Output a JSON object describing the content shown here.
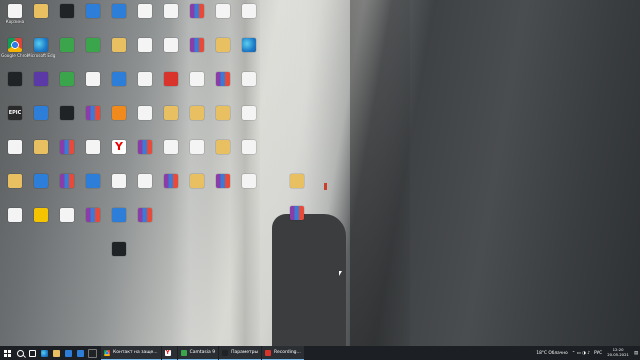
{
  "desktop": {
    "colors": {
      "taskbar_bg": "#1c1f23",
      "active_underline": "#76b9ed"
    },
    "icons": [
      {
        "label": "Корзина",
        "glyph": "recycle-bin"
      },
      {
        "label": "",
        "glyph": "folder"
      },
      {
        "label": "",
        "glyph": "app-dark"
      },
      {
        "label": "",
        "glyph": "app-blue"
      },
      {
        "label": "steam-icon",
        "glyph": "steam"
      },
      {
        "label": "",
        "glyph": "document"
      },
      {
        "label": "",
        "glyph": "document"
      },
      {
        "label": "",
        "glyph": "winrar-archive"
      },
      {
        "label": "",
        "glyph": "document"
      },
      {
        "label": "",
        "glyph": "document"
      },
      {
        "label": "Google Chrome",
        "glyph": "chrome"
      },
      {
        "label": "Microsoft Edge",
        "glyph": "edge"
      },
      {
        "label": "",
        "glyph": "app-green"
      },
      {
        "label": "",
        "glyph": "app-green"
      },
      {
        "label": "",
        "glyph": "folder"
      },
      {
        "label": "",
        "glyph": "document"
      },
      {
        "label": "",
        "glyph": "document"
      },
      {
        "label": "",
        "glyph": "winrar-archive"
      },
      {
        "label": "",
        "glyph": "folder"
      },
      {
        "label": "",
        "glyph": "edge"
      },
      {
        "label": "",
        "glyph": "app-dark"
      },
      {
        "label": "",
        "glyph": "app-purple"
      },
      {
        "label": "",
        "glyph": "app-green"
      },
      {
        "label": "",
        "glyph": "document"
      },
      {
        "label": "",
        "glyph": "app-blue"
      },
      {
        "label": "",
        "glyph": "document"
      },
      {
        "label": "",
        "glyph": "app-red"
      },
      {
        "label": "",
        "glyph": "document"
      },
      {
        "label": "",
        "glyph": "winrar-archive"
      },
      {
        "label": "",
        "glyph": "document"
      },
      {
        "label": "EPIC",
        "glyph": "epic-games"
      },
      {
        "label": "",
        "glyph": "app-blue"
      },
      {
        "label": "",
        "glyph": "app-dark"
      },
      {
        "label": "",
        "glyph": "winrar-archive"
      },
      {
        "label": "",
        "glyph": "app-orange"
      },
      {
        "label": "",
        "glyph": "document"
      },
      {
        "label": "",
        "glyph": "folder"
      },
      {
        "label": "",
        "glyph": "folder"
      },
      {
        "label": "",
        "glyph": "folder"
      },
      {
        "label": "",
        "glyph": "document"
      },
      {
        "label": "",
        "glyph": "document"
      },
      {
        "label": "",
        "glyph": "folder"
      },
      {
        "label": "",
        "glyph": "winrar-archive"
      },
      {
        "label": "",
        "glyph": "document"
      },
      {
        "label": "Y",
        "glyph": "yandex"
      },
      {
        "label": "",
        "glyph": "winrar-archive"
      },
      {
        "label": "",
        "glyph": "document"
      },
      {
        "label": "",
        "glyph": "document"
      },
      {
        "label": "",
        "glyph": "folder"
      },
      {
        "label": "",
        "glyph": "document"
      },
      {
        "label": "",
        "glyph": "folder"
      },
      {
        "label": "",
        "glyph": "app-blue"
      },
      {
        "label": "",
        "glyph": "winrar-archive"
      },
      {
        "label": "",
        "glyph": "app-blue"
      },
      {
        "label": "",
        "glyph": "document"
      },
      {
        "label": "",
        "glyph": "document"
      },
      {
        "label": "",
        "glyph": "winrar-archive"
      },
      {
        "label": "",
        "glyph": "folder"
      },
      {
        "label": "",
        "glyph": "winrar-archive"
      },
      {
        "label": "",
        "glyph": "document"
      },
      {
        "label": "",
        "glyph": "document"
      },
      {
        "label": "",
        "glyph": "app-yellow"
      },
      {
        "label": "",
        "glyph": "document"
      },
      {
        "label": "",
        "glyph": "winrar-archive"
      },
      {
        "label": "",
        "glyph": "app-blue"
      },
      {
        "label": "",
        "glyph": "winrar-archive"
      },
      {
        "label": "",
        "glyph": "app-dark"
      }
    ]
  },
  "taskbar": {
    "tasks": [
      {
        "label": "Контакт на заще...",
        "glyph": "chrome"
      },
      {
        "label": "",
        "glyph": "yandex"
      },
      {
        "label": "Camtasia 9",
        "glyph": "app-green"
      },
      {
        "label": "Параметры",
        "glyph": "gear"
      },
      {
        "label": "Recording...",
        "glyph": "app-red"
      }
    ],
    "tray": {
      "weather": "18°C  Облачно",
      "language": "РУС",
      "time": "12:20",
      "date": "20.05.2021"
    }
  }
}
